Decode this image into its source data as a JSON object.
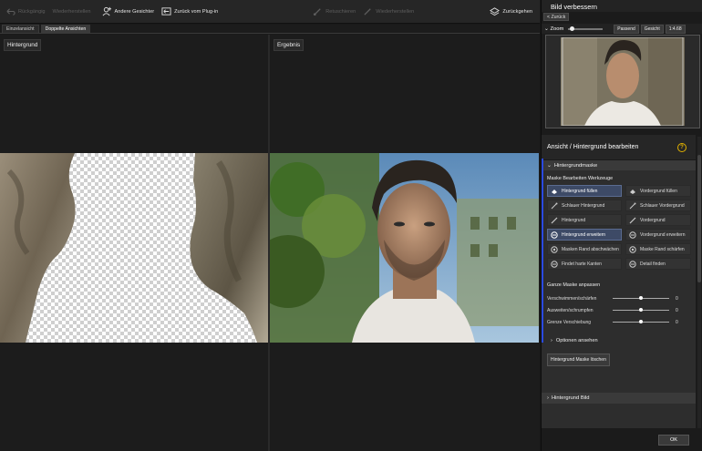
{
  "toolbar": {
    "undo": "Rückgängig",
    "redo": "Wiederherstellen",
    "other_faces": "Andere Gesichter",
    "back_to_plugin": "Zurück vom Plug-in",
    "retouch": "Retuschieren",
    "restore": "Wiederherstellen",
    "reset": "Zurückgehen"
  },
  "tabs": {
    "single": "Einzelansicht",
    "double": "Doppelte Ansichten"
  },
  "panels": {
    "left_label": "Hintergrund",
    "right_label": "Ergebnis"
  },
  "sidebar": {
    "title": "Bild verbessern",
    "back": "< Zurück",
    "zoom_label": "Zoom",
    "zoom_fit": "Passend",
    "zoom_face": "Gesicht",
    "zoom_ratio": "1:4.68",
    "edit_title": "Ansicht / Hintergrund bearbeiten",
    "help": "?",
    "mask_section": "Hintergrundmaske",
    "tools_title": "Maske Bearbeiten Werkzeuge",
    "tools": [
      {
        "label": "Hintergrund füllen",
        "selected": true
      },
      {
        "label": "Vordergrund füllen",
        "selected": false
      },
      {
        "label": "Schlauer Hintergrund",
        "selected": false
      },
      {
        "label": "Schlauer Vordergrund",
        "selected": false
      },
      {
        "label": "Hintergrund",
        "selected": false
      },
      {
        "label": "Vordergrund",
        "selected": false
      },
      {
        "label": "Hintergrund erweitern",
        "selected": true
      },
      {
        "label": "Vordergrund erweitern",
        "selected": false
      },
      {
        "label": "Masken Rand abschwächen",
        "selected": false
      },
      {
        "label": "Maske Rand schärfen",
        "selected": false
      },
      {
        "label": "Findet harte Kanten",
        "selected": false
      },
      {
        "label": "Detail finden",
        "selected": false
      }
    ],
    "adjust_title": "Ganze Maske anpassen",
    "sliders": [
      {
        "label": "Verschwimmen/schärfen",
        "value": "0"
      },
      {
        "label": "Ausweiten/schrumpfen",
        "value": "0"
      },
      {
        "label": "Grenze Verschiebung",
        "value": "0"
      }
    ],
    "options": "Optionen ansehen",
    "delete_mask": "Hintergrund Maske löschen",
    "bild_section": "Hintergrund Bild",
    "ok": "OK"
  }
}
